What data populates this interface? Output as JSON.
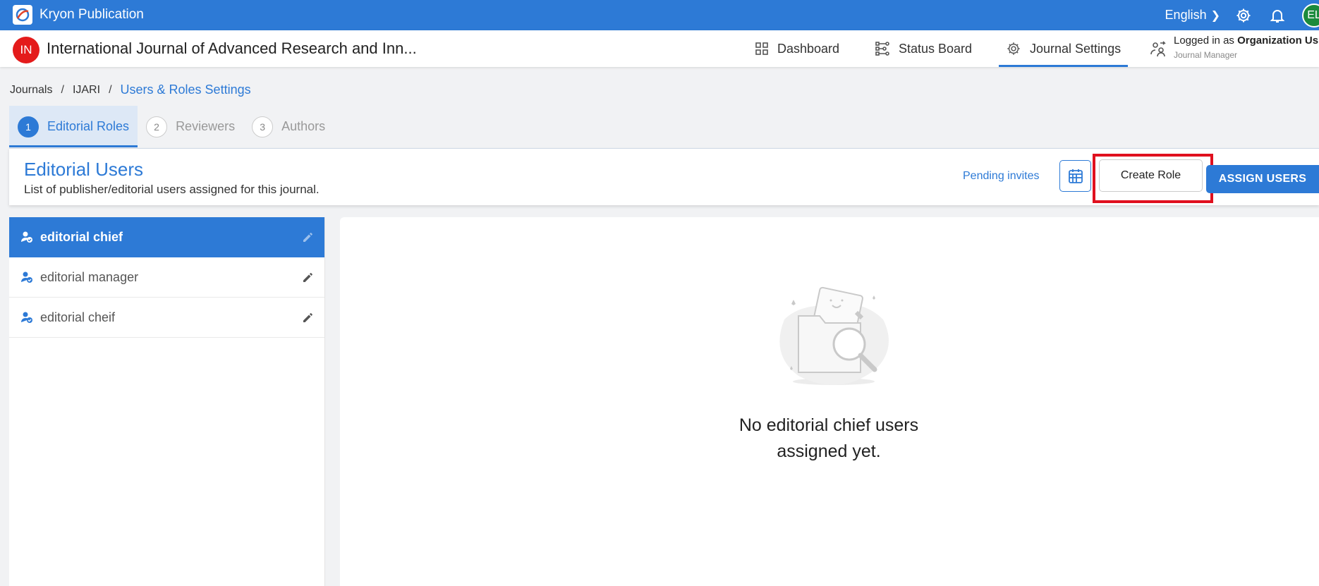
{
  "app": {
    "brand_name": "Kryon Publication",
    "language": "English",
    "user_initials": "EL"
  },
  "journal": {
    "initials": "IN",
    "title": "International Journal of Advanced Research and Inn..."
  },
  "nav": {
    "dashboard": "Dashboard",
    "status_board": "Status Board",
    "journal_settings": "Journal Settings",
    "active": "Journal Settings"
  },
  "login": {
    "prefix": "Logged in as ",
    "name": "Organization Us",
    "role": "Journal Manager"
  },
  "breadcrumb": {
    "items": [
      "Journals",
      "IJARI",
      "Users & Roles Settings"
    ]
  },
  "tabs": [
    {
      "num": "1",
      "label": "Editorial Roles"
    },
    {
      "num": "2",
      "label": "Reviewers"
    },
    {
      "num": "3",
      "label": "Authors"
    }
  ],
  "card": {
    "title": "Editorial Users",
    "subtitle": "List of publisher/editorial users assigned for this journal.",
    "pending_invites": "Pending invites",
    "create_role": "Create Role",
    "assign_users": "ASSIGN USERS"
  },
  "roles": [
    {
      "label": "editorial chief",
      "active": true
    },
    {
      "label": "editorial manager",
      "active": false
    },
    {
      "label": "editorial cheif",
      "active": false
    }
  ],
  "empty_state": {
    "line1": "No editorial chief users",
    "line2": "assigned yet."
  },
  "colors": {
    "primary": "#2d7ad6",
    "highlight_box": "#e0101e",
    "journal_badge": "#e41b1b",
    "user_avatar": "#1b8a3c"
  }
}
